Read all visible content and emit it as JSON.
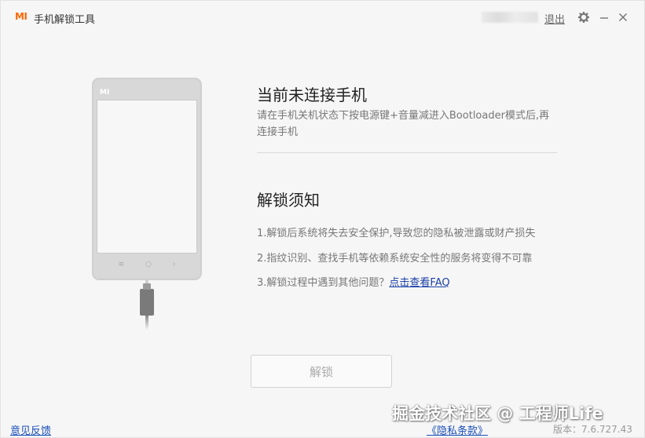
{
  "titlebar": {
    "logo_text": "MI",
    "app_title": "手机解锁工具",
    "logout_label": "退出",
    "icons": [
      "gear-icon",
      "minimize-icon",
      "close-icon"
    ]
  },
  "phone": {
    "logo_text": "MI"
  },
  "status": {
    "title": "当前未连接手机",
    "description": "请在手机关机状态下按电源键+音量减进入Bootloader模式后,再连接手机"
  },
  "notes": {
    "title": "解锁须知",
    "item1": "1.解锁后系统将失去安全保护,导致您的隐私被泄露或财产损失",
    "item2": "2.指纹识别、查找手机等依赖系统安全性的服务将变得不可靠",
    "item3_prefix": "3.解锁过程中遇到其他问题？",
    "item3_link": "点击查看FAQ"
  },
  "unlock_button": "解锁",
  "footer": {
    "feedback": "意见反馈",
    "privacy": "《隐私条款》",
    "version": "版本：7.6.727.43"
  },
  "watermark": "掘金技术社区 @ 工程师Life",
  "colors": {
    "brand": "#ff6700",
    "link": "#1a4fb8",
    "background": "#f6f6f6"
  }
}
